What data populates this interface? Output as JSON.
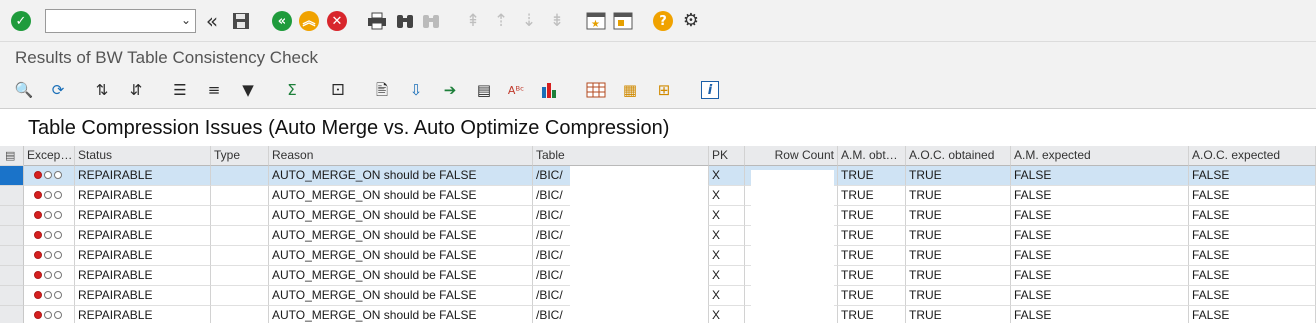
{
  "toolbar": {
    "command_field_value": "",
    "icons": [
      "enter-check-icon",
      "back-to-start-icon",
      "save-icon",
      "back-icon",
      "exit-icon",
      "cancel-icon",
      "print-icon",
      "find-icon",
      "find-next-icon",
      "first-page-icon",
      "previous-page-icon",
      "next-page-icon",
      "last-page-icon",
      "new-session-icon",
      "shortcut-icon",
      "help-icon",
      "customize-layout-icon"
    ]
  },
  "page_title": "Results of BW Table Consistency Check",
  "alv_toolbar": {
    "icons": [
      "details-icon",
      "refresh-icon",
      "sort-ascending-icon",
      "sort-descending-icon",
      "center-align-icon",
      "align-icon",
      "filter-icon",
      "sum-icon",
      "subtotal-icon",
      "print-preview-icon",
      "export-icon",
      "send-icon",
      "word-processing-icon",
      "abc-analysis-icon",
      "graphic-icon",
      "change-layout-icon",
      "select-layout-icon",
      "save-layout-icon",
      "information-icon"
    ],
    "sum_glyph": "Σ",
    "abc_glyph": "Aᴮᶜ",
    "info_glyph": "i"
  },
  "list_title": "Table Compression Issues (Auto Merge vs. Auto Optimize Compression)",
  "table": {
    "columns": [
      "Excep…",
      "Status",
      "Type",
      "Reason",
      "Table",
      "PK",
      "Row Count",
      "A.M. obt…",
      "A.O.C. obtained",
      "A.M. expected",
      "A.O.C. expected"
    ],
    "rows": [
      {
        "status": "REPAIRABLE",
        "type": "",
        "reason": "AUTO_MERGE_ON should be FALSE",
        "table": "/BIC/",
        "pk": "X",
        "row_count": "",
        "am_obtained": "TRUE",
        "aoc_obtained": "TRUE",
        "am_expected": "FALSE",
        "aoc_expected": "FALSE",
        "exception": "red"
      },
      {
        "status": "REPAIRABLE",
        "type": "",
        "reason": "AUTO_MERGE_ON should be FALSE",
        "table": "/BIC/",
        "pk": "X",
        "row_count": "",
        "am_obtained": "TRUE",
        "aoc_obtained": "TRUE",
        "am_expected": "FALSE",
        "aoc_expected": "FALSE",
        "exception": "red"
      },
      {
        "status": "REPAIRABLE",
        "type": "",
        "reason": "AUTO_MERGE_ON should be FALSE",
        "table": "/BIC/",
        "pk": "X",
        "row_count": "",
        "am_obtained": "TRUE",
        "aoc_obtained": "TRUE",
        "am_expected": "FALSE",
        "aoc_expected": "FALSE",
        "exception": "red"
      },
      {
        "status": "REPAIRABLE",
        "type": "",
        "reason": "AUTO_MERGE_ON should be FALSE",
        "table": "/BIC/",
        "pk": "X",
        "row_count": "",
        "am_obtained": "TRUE",
        "aoc_obtained": "TRUE",
        "am_expected": "FALSE",
        "aoc_expected": "FALSE",
        "exception": "red"
      },
      {
        "status": "REPAIRABLE",
        "type": "",
        "reason": "AUTO_MERGE_ON should be FALSE",
        "table": "/BIC/",
        "pk": "X",
        "row_count": "",
        "am_obtained": "TRUE",
        "aoc_obtained": "TRUE",
        "am_expected": "FALSE",
        "aoc_expected": "FALSE",
        "exception": "red"
      },
      {
        "status": "REPAIRABLE",
        "type": "",
        "reason": "AUTO_MERGE_ON should be FALSE",
        "table": "/BIC/",
        "pk": "X",
        "row_count": "",
        "am_obtained": "TRUE",
        "aoc_obtained": "TRUE",
        "am_expected": "FALSE",
        "aoc_expected": "FALSE",
        "exception": "red"
      },
      {
        "status": "REPAIRABLE",
        "type": "",
        "reason": "AUTO_MERGE_ON should be FALSE",
        "table": "/BIC/",
        "pk": "X",
        "row_count": "",
        "am_obtained": "TRUE",
        "aoc_obtained": "TRUE",
        "am_expected": "FALSE",
        "aoc_expected": "FALSE",
        "exception": "red"
      },
      {
        "status": "REPAIRABLE",
        "type": "",
        "reason": "AUTO_MERGE_ON should be FALSE",
        "table": "/BIC/",
        "pk": "X",
        "row_count": "",
        "am_obtained": "TRUE",
        "aoc_obtained": "TRUE",
        "am_expected": "FALSE",
        "aoc_expected": "FALSE",
        "exception": "red"
      }
    ],
    "selected_row": 0
  },
  "colors": {
    "toolbar_bg": "#f2f2f2",
    "header_bg": "#e9eaec",
    "selected_row": "#cfe3f4",
    "row_selector_active": "#1a73c9",
    "exception_red": "#d61f1f"
  }
}
